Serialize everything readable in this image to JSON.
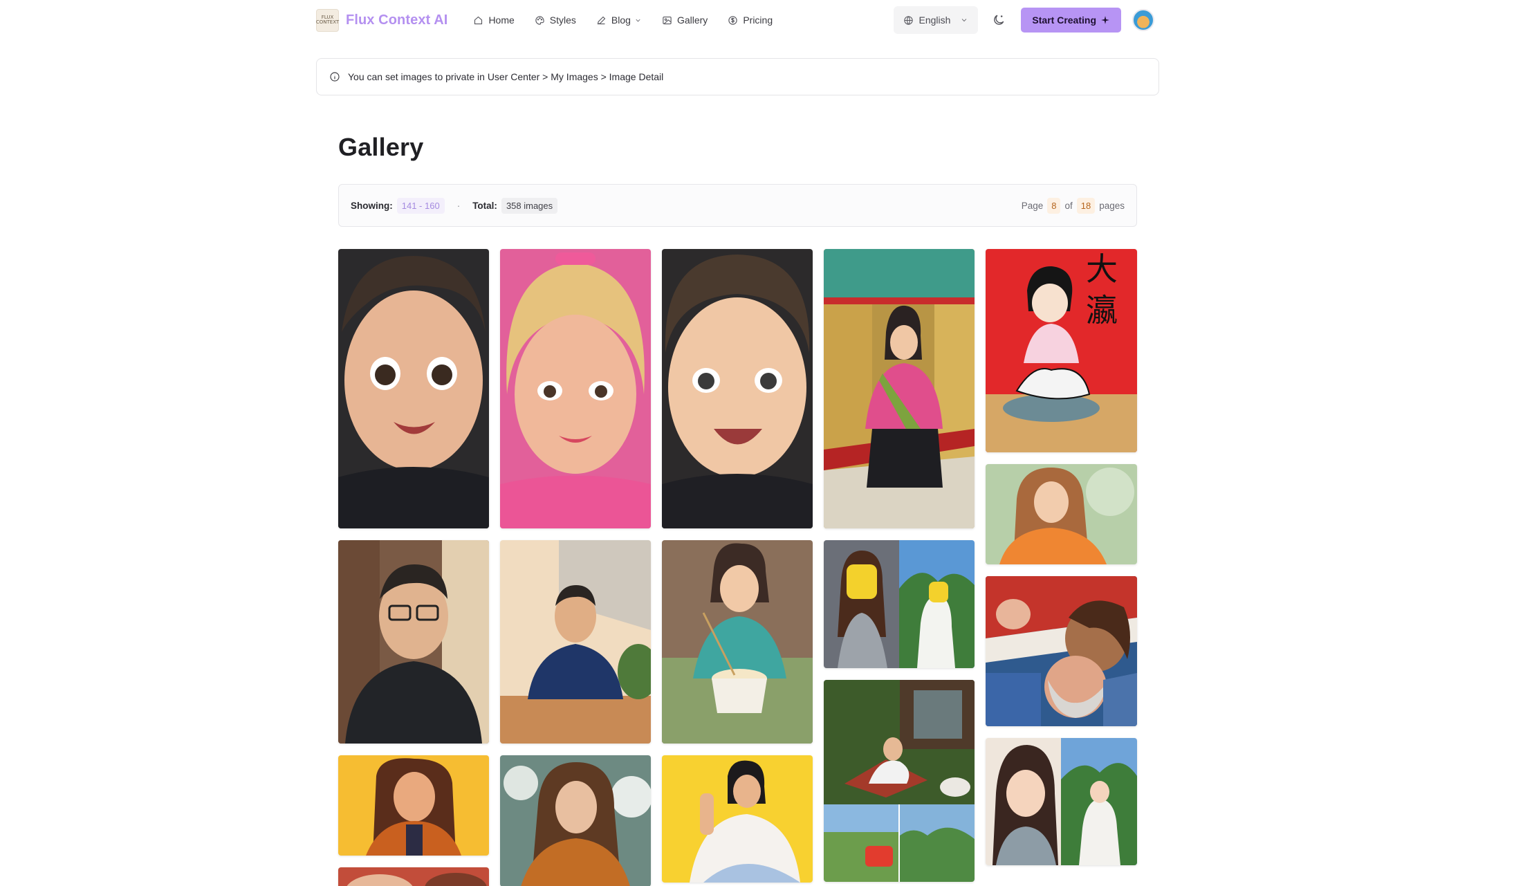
{
  "brand": {
    "logo_text": "FLUX CONTEXT",
    "name": "Flux Context AI"
  },
  "nav": {
    "home": "Home",
    "styles": "Styles",
    "blog": "Blog",
    "gallery": "Gallery",
    "pricing": "Pricing"
  },
  "language": {
    "selected": "English"
  },
  "cta": {
    "label": "Start Creating"
  },
  "notice": {
    "text": "You can set images to private in User Center > My Images > Image Detail"
  },
  "page": {
    "title": "Gallery"
  },
  "stats": {
    "showing_label": "Showing:",
    "showing_value": "141 - 160",
    "separator": "·",
    "total_label": "Total:",
    "total_value": "358 images",
    "page_word": "Page",
    "current_page": "8",
    "of_word": "of",
    "total_pages": "18",
    "pages_word": "pages"
  },
  "colors": {
    "brand": "#b490f0",
    "cta": "#b794f4",
    "accent_text": "#a58be0",
    "page_badge": "#b5651d"
  },
  "gallery": {
    "images": [
      {
        "name": "cartoon-baby-boy"
      },
      {
        "name": "cartoon-blonde-girl-pink"
      },
      {
        "name": "cartoon-boy-smiling"
      },
      {
        "name": "woman-in-temple-corridor"
      },
      {
        "name": "child-ink-drawing-red"
      },
      {
        "name": "watercolor-girl-orange-jacket"
      },
      {
        "name": "family-selfie-rotated"
      },
      {
        "name": "cartoon-man-glasses-black-sweater"
      },
      {
        "name": "cartoon-man-suit-office"
      },
      {
        "name": "anime-girl-eating-noodles"
      },
      {
        "name": "lego-woman-and-anime-field"
      },
      {
        "name": "woman-relaxing-garden-collage"
      },
      {
        "name": "anime-woman-diptych"
      },
      {
        "name": "pixel-art-curly-girl"
      },
      {
        "name": "girl-curly-hair-orange-jacket-snow"
      },
      {
        "name": "pixel-art-woman-yellow"
      },
      {
        "name": "partial-bottom-image"
      }
    ]
  }
}
